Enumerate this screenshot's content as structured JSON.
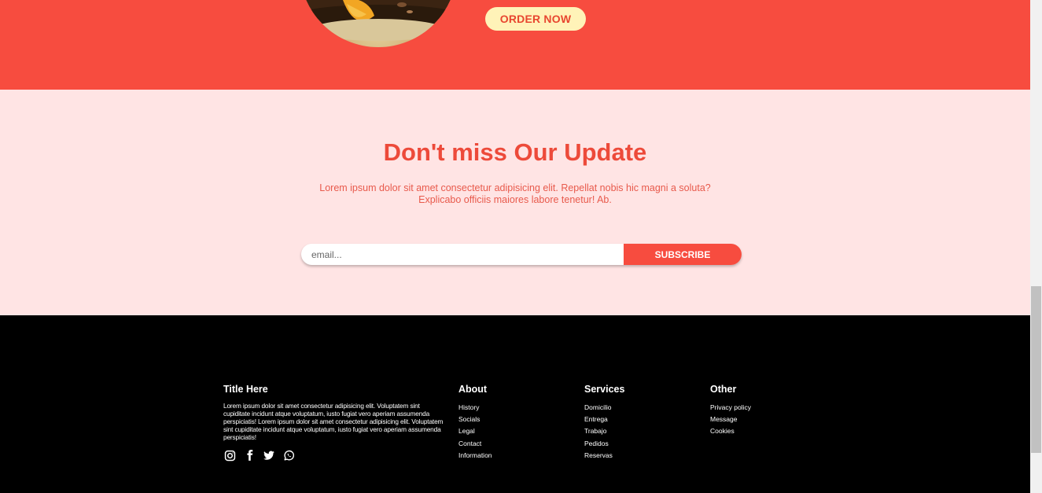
{
  "hero": {
    "order_label": "ORDER NOW"
  },
  "newsletter": {
    "title": "Don't miss Our Update",
    "text_line1": "Lorem ipsum dolor sit amet consectetur adipisicing elit. Repellat nobis hic magni a soluta?",
    "text_line2": "Explicabo officiis maiores labore tenetur! Ab.",
    "email_placeholder": "email...",
    "subscribe_label": "SUBSCRIBE"
  },
  "footer": {
    "col1": {
      "title": "Title Here",
      "description": "Lorem ipsum dolor sit amet consectetur adipisicing elit. Voluptatem sint cupiditate incidunt atque voluptatum, iusto fugiat vero aperiam assumenda perspiciatis! Lorem ipsum dolor sit amet consectetur adipisicing elit. Voluptatem sint cupiditate incidunt atque voluptatum, iusto fugiat vero aperiam assumenda perspiciatis!",
      "socials": [
        "instagram-icon",
        "facebook-icon",
        "twitter-icon",
        "whatsapp-icon"
      ]
    },
    "about": {
      "title": "About",
      "items": [
        "History",
        "Socials",
        "Legal",
        "Contact",
        "Information"
      ]
    },
    "services": {
      "title": "Services",
      "items": [
        "Domicilio",
        "Entrega",
        "Trabajo",
        "Pedidos",
        "Reservas"
      ]
    },
    "other": {
      "title": "Other",
      "items": [
        "Privacy policy",
        "Message",
        "Cookies"
      ]
    }
  },
  "colors": {
    "accent": "#f74c3f",
    "newsletter_bg": "#ffe4e4",
    "order_button_bg": "#fff3b8",
    "footer_bg": "#000000"
  }
}
